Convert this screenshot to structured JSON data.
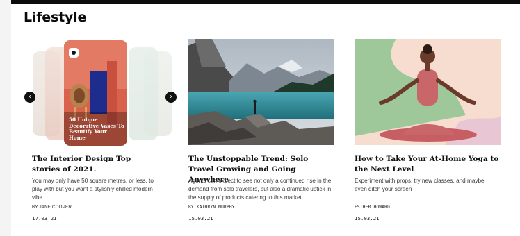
{
  "section": {
    "title": "Lifestyle"
  },
  "cards": [
    {
      "story_label": "50 Unique Decorative Vases To Beautify Your Home",
      "title": "The Interior Design Top stories of 2021.",
      "excerpt": "You may only have 50 square metres, or less, to play with but you want a stylishly chilled modern vibe.",
      "byline": "BY JANE COOPER",
      "date": "17.03.21",
      "arrow_left": "‹",
      "arrow_right": "›"
    },
    {
      "title": "The Unstoppable Trend: Solo Travel Growing and Going Anywhere",
      "excerpt": "Agents can expect to see not only a continued rise in the demand from solo travelers, but also a dramatic uptick in the supply of products catering to this market.",
      "byline": "BY KATHRYN MURPHY",
      "date": "15.03.21"
    },
    {
      "title": "How to Take Your At-Home Yoga to the Next Level",
      "excerpt": "Experiment with props, try new classes, and maybe even ditch your screen",
      "byline": "ESTHER HOWARD",
      "date": "15.03.21"
    }
  ],
  "colors": {
    "top_bar": "#0c0c0c",
    "accent_story": "#d8624c",
    "yoga_green": "#9ec79a",
    "yoga_pink": "#c9666a"
  }
}
